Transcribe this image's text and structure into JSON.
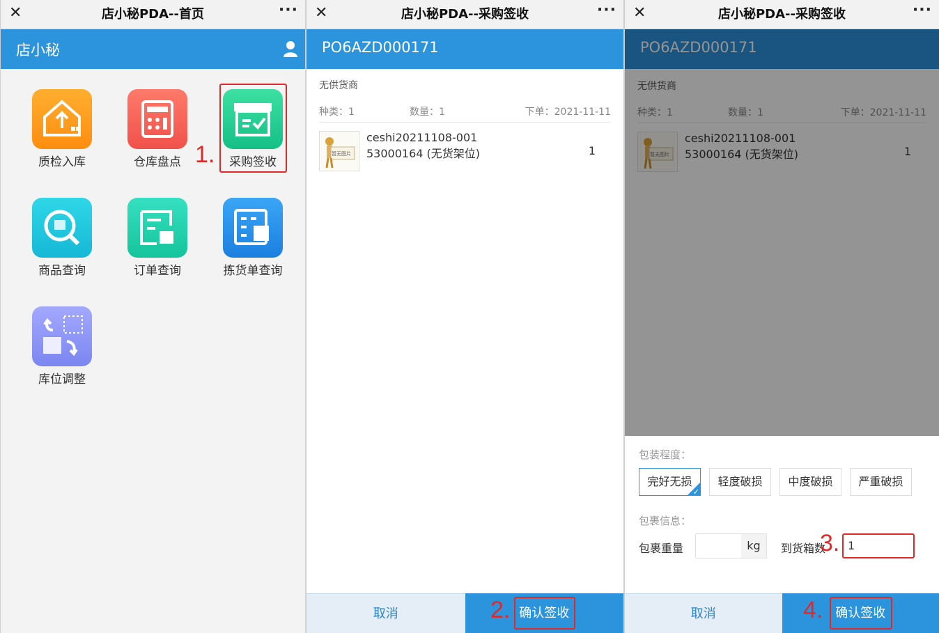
{
  "panel1": {
    "window_title": "店小秘PDA--首页",
    "header_title": "店小秘",
    "tiles": [
      {
        "label": "质检入库",
        "icon": "upload-warehouse-icon"
      },
      {
        "label": "仓库盘点",
        "icon": "calculator-icon"
      },
      {
        "label": "采购签收",
        "icon": "box-check-icon"
      },
      {
        "label": "商品查询",
        "icon": "search-box-icon"
      },
      {
        "label": "订单查询",
        "icon": "order-doc-icon"
      },
      {
        "label": "拣货单查询",
        "icon": "picklist-icon"
      },
      {
        "label": "库位调整",
        "icon": "swap-location-icon"
      }
    ],
    "step_label": "1."
  },
  "panel2": {
    "window_title": "店小秘PDA--采购签收",
    "po_number": "PO6AZD000171",
    "supplier": "无供货商",
    "kinds": "种类：1",
    "quantity": "数量：1",
    "order_date": "下单：2021-11-11",
    "item": {
      "name": "ceshi20211108-001",
      "sku": "53000164 (无货架位)",
      "qty": "1",
      "thumb_text": "暂无图片"
    },
    "cancel_label": "取消",
    "confirm_label": "确认签收",
    "step_label": "2."
  },
  "panel3": {
    "window_title": "店小秘PDA--采购签收",
    "po_number": "PO6AZD000171",
    "supplier": "无供货商",
    "kinds": "种类：1",
    "quantity": "数量：1",
    "order_date": "下单：2021-11-11",
    "item": {
      "name": "ceshi20211108-001",
      "sku": "53000164 (无货架位)",
      "qty": "1",
      "thumb_text": "暂无图片"
    },
    "packaging_label": "包装程度：",
    "packaging_options": [
      "完好无损",
      "轻度破损",
      "中度破损",
      "严重破损"
    ],
    "packaging_selected": "完好无损",
    "parcel_label": "包裹信息：",
    "weight_label": "包裹重量",
    "weight_value": "",
    "weight_unit": "kg",
    "box_count_label": "到货箱数",
    "box_count_value": "1",
    "cancel_label": "取消",
    "confirm_label": "确认签收",
    "step3_label": "3.",
    "step4_label": "4."
  },
  "colors": {
    "accent": "#2c93dd",
    "highlight": "#e02a2a"
  }
}
